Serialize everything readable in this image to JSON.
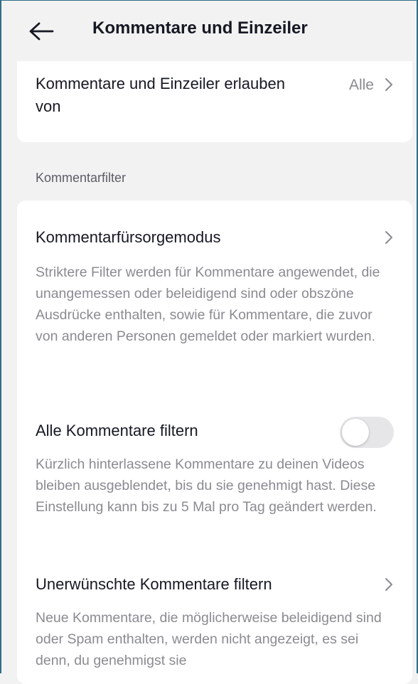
{
  "header": {
    "title": "Kommentare und Einzeiler",
    "back_icon": "arrow-left-icon"
  },
  "allow_row": {
    "title": "Kommentare und Einzeiler erlauben von",
    "value": "Alle"
  },
  "section": {
    "label": "Kommentarfilter"
  },
  "filters": [
    {
      "title": "Kommentarfürsorgemodus",
      "description": "Striktere Filter werden für Kommentare angewendet, die unangemessen oder beleidigend sind oder obszöne Ausdrücke enthalten, sowie für Kommentare, die zuvor von anderen Personen gemeldet oder markiert wurden.",
      "control": "chevron"
    },
    {
      "title": "Alle Kommentare filtern",
      "description": "Kürzlich hinterlassene Kommentare zu deinen Videos bleiben ausgeblendet, bis du sie genehmigt hast. Diese Einstellung kann bis zu 5 Mal pro Tag geändert werden.",
      "control": "toggle",
      "enabled": false
    },
    {
      "title": "Unerwünschte Kommentare filtern",
      "description": "Neue Kommentare, die möglicherweise beleidigend sind oder Spam enthalten, werden nicht angezeigt, es sei denn, du genehmigst sie",
      "control": "chevron"
    }
  ],
  "colors": {
    "background": "#f2f2f2",
    "card": "#ffffff",
    "text_primary": "#161823",
    "text_secondary": "#8a8b91",
    "toggle_off": "#e6e6e8"
  }
}
